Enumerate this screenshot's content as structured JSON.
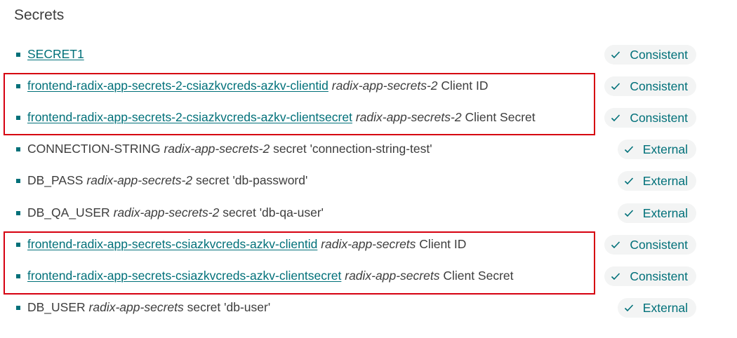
{
  "section": {
    "title": "Secrets"
  },
  "colors": {
    "accent": "#007079",
    "badge_bg": "#f3f4f4",
    "highlight": "#d60010"
  },
  "rows": [
    {
      "link": "SECRET1",
      "source": "",
      "suffix": "",
      "status": "Consistent"
    },
    {
      "link": "frontend-radix-app-secrets-2-csiazkvcreds-azkv-clientid",
      "source": "radix-app-secrets-2",
      "suffix": "Client ID",
      "status": "Consistent"
    },
    {
      "link": "frontend-radix-app-secrets-2-csiazkvcreds-azkv-clientsecret",
      "source": "radix-app-secrets-2",
      "suffix": "Client Secret",
      "status": "Consistent"
    },
    {
      "name": "CONNECTION-STRING",
      "source": "radix-app-secrets-2",
      "suffix": "secret 'connection-string-test'",
      "status": "External"
    },
    {
      "name": "DB_PASS",
      "source": "radix-app-secrets-2",
      "suffix": "secret 'db-password'",
      "status": "External"
    },
    {
      "name": "DB_QA_USER",
      "source": "radix-app-secrets-2",
      "suffix": "secret 'db-qa-user'",
      "status": "External"
    },
    {
      "link": "frontend-radix-app-secrets-csiazkvcreds-azkv-clientid",
      "source": "radix-app-secrets",
      "suffix": "Client ID",
      "status": "Consistent"
    },
    {
      "link": "frontend-radix-app-secrets-csiazkvcreds-azkv-clientsecret",
      "source": "radix-app-secrets",
      "suffix": "Client Secret",
      "status": "Consistent"
    },
    {
      "name": "DB_USER",
      "source": "radix-app-secrets",
      "suffix": "secret 'db-user'",
      "status": "External"
    }
  ]
}
